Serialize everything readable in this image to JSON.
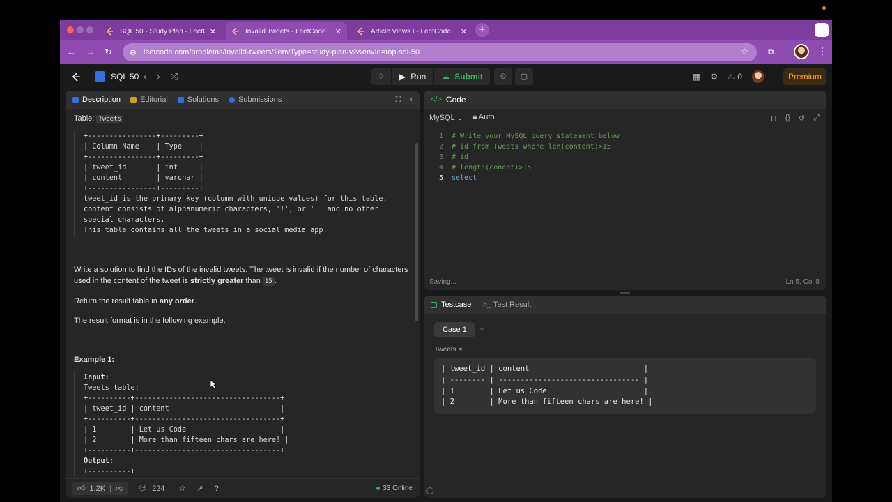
{
  "browser": {
    "tabs": [
      {
        "title": "SQL 50 - Study Plan - LeetCode",
        "active": false
      },
      {
        "title": "Invalid Tweets - LeetCode",
        "active": true
      },
      {
        "title": "Article Views I - LeetCode",
        "active": false
      }
    ],
    "url": "leetcode.com/problems/invalid-tweets/?envType=study-plan-v2&envId=top-sql-50",
    "tab_bar_color": "#7d3c9e"
  },
  "lc_nav": {
    "list_name": "SQL 50",
    "run_label": "Run",
    "submit_label": "Submit",
    "streak_count": "0",
    "premium_label": "Premium"
  },
  "left_panel": {
    "tabs": [
      "Description",
      "Editorial",
      "Solutions",
      "Submissions"
    ],
    "table_label": "Table:",
    "table_name": "Tweets",
    "schema": "+----------------+---------+\n| Column Name    | Type    |\n+----------------+---------+\n| tweet_id       | int     |\n| content        | varchar |\n+----------------+---------+\ntweet_id is the primary key (column with unique values) for this table.\ncontent consists of alphanumeric characters, '!', or ' ' and no other\nspecial characters.\nThis table contains all the tweets in a social media app.",
    "problem_p1": "Write a solution to find the IDs of the invalid tweets. The tweet is invalid if the number of characters used in the content of the tweet is",
    "problem_bold": "strictly greater",
    "problem_than": "than",
    "problem_num": "15",
    "return_pre": "Return the result table in",
    "return_bold": "any order",
    "format_text": "The result format is in the following example.",
    "example_title": "Example 1:",
    "input_label": "Input:",
    "example_block": "Tweets table:\n+----------+----------------------------------+\n| tweet_id | content                          |\n+----------+----------------------------------+\n| 1        | Let us Code                      |\n| 2        | More than fifteen chars are here! |\n+----------+----------------------------------+",
    "output_label": "Output:",
    "output_line": "+----------+",
    "likes": "1.2K",
    "comments": "224",
    "online": "33 Online"
  },
  "code_panel": {
    "title": "Code",
    "language": "MySQL",
    "mode": "Auto",
    "lines": [
      "# Write your MySQL query statement below",
      "# id from Tweets where len(content)>15",
      "# id",
      "# length(conent)>15",
      "select"
    ],
    "line_numbers": [
      "1",
      "2",
      "3",
      "4",
      "5"
    ],
    "status": "Saving...",
    "position": "Ln 5, Col 8"
  },
  "test_panel": {
    "tab_testcase": "Testcase",
    "tab_result": "Test Result",
    "case_label": "Case 1",
    "input_label": "Tweets =",
    "input_value": "| tweet_id | content                          |\n| -------- | -------------------------------- |\n| 1        | Let us Code                      |\n| 2        | More than fifteen chars are here! |"
  }
}
